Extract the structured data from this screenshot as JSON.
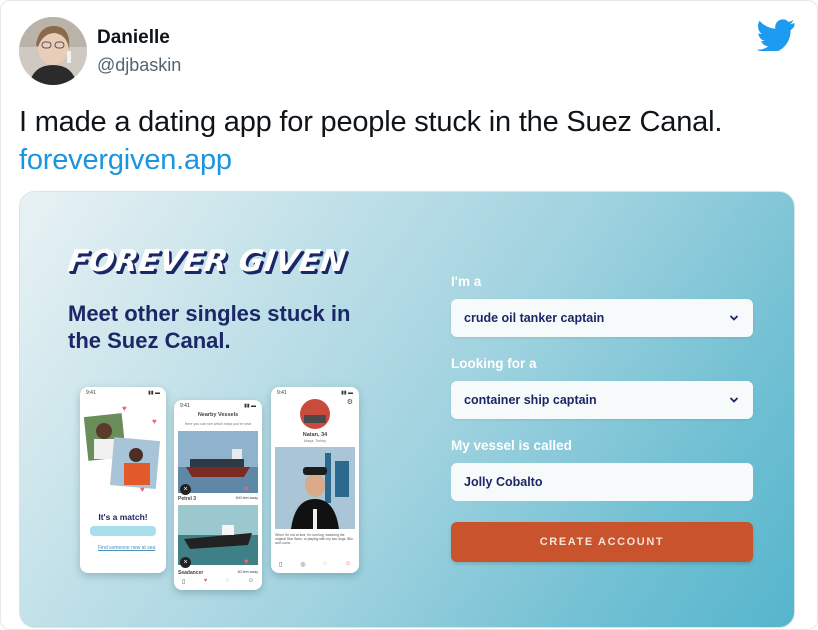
{
  "tweet": {
    "author_name": "Danielle",
    "author_handle": "@djbaskin",
    "text": "I made a dating app for people stuck in the Suez Canal.",
    "link": "forevergiven.app"
  },
  "icons": {
    "platform": "twitter-bird-icon",
    "dropdown": "chevron-down-icon"
  },
  "colors": {
    "link": "#1b95e0",
    "brand_navy": "#1b2766",
    "cta": "#c9532c",
    "twitter_blue": "#1d9bf0"
  },
  "card": {
    "logo": "FOREVER GIVEN",
    "headline": "Meet other singles stuck in the Suez Canal.",
    "form": {
      "im_a_label": "I'm a",
      "im_a_value": "crude oil tanker captain",
      "looking_label": "Looking for a",
      "looking_value": "container ship captain",
      "vessel_label": "My vessel is called",
      "vessel_value": "Jolly Cobalto",
      "submit": "CREATE ACCOUNT"
    },
    "phones": {
      "match": {
        "time": "9:41",
        "title": "It's a match!",
        "footer": "Find someone new at sea"
      },
      "vessels": {
        "time": "9:41",
        "title": "Nearby Vessels",
        "subtitle": "Here you can see which ships you're near",
        "ship1": "Petrel 3",
        "ship1_meta": "600 feet away",
        "ship2": "Seadancer",
        "ship2_meta": "80 feet away"
      },
      "profile": {
        "time": "9:41",
        "name": "Natan, 34",
        "location": "Ataqa, Turkey",
        "bio": "When I'm not at sea, I'm running, watching the original Star Wars, or playing with my two dogs: Bilo and Lucia."
      }
    }
  }
}
